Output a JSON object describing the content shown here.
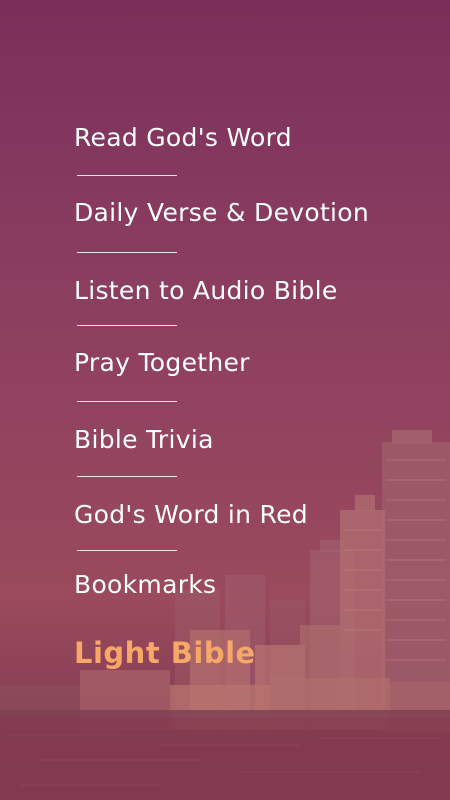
{
  "menu": {
    "items": [
      {
        "label": "Read God's Word"
      },
      {
        "label": "Daily Verse & Devotion"
      },
      {
        "label": "Listen to Audio Bible"
      },
      {
        "label": "Pray Together"
      },
      {
        "label": "Bible Trivia"
      },
      {
        "label": "God's Word in Red"
      },
      {
        "label": "Bookmarks"
      }
    ]
  },
  "brand": {
    "name": "Light Bible"
  },
  "colors": {
    "overlay": "#8a3a5e",
    "text": "#ffffff",
    "brand_accent": "#f6a869"
  },
  "background": {
    "icon": "city-skyline-image"
  }
}
